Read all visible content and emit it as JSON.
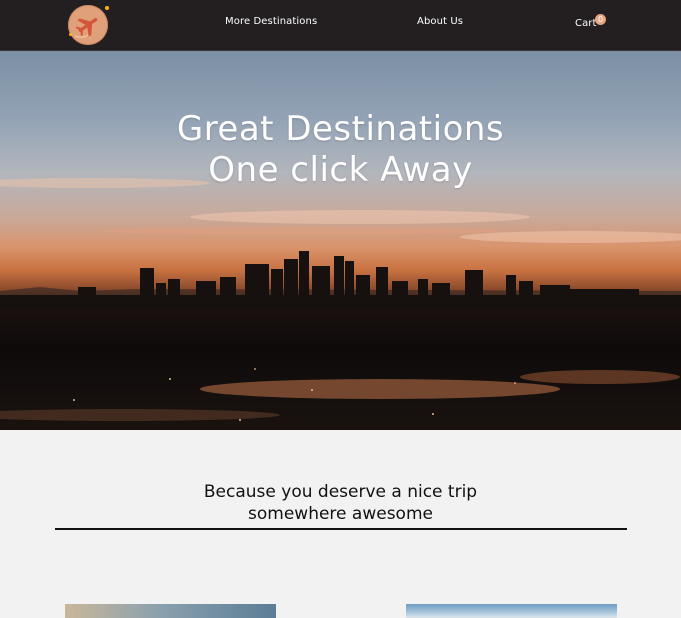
{
  "header": {
    "nav": {
      "more_destinations": "More Destinations",
      "about_us": "About Us",
      "cart_label": "Cart",
      "cart_count": "0"
    },
    "logo_icon": "airplane-logo-icon"
  },
  "hero": {
    "title_line1": "Great Destinations",
    "title_line2": "One click Away",
    "image": "city-skyline-sunset"
  },
  "tagline": {
    "line1": "Because you deserve a nice trip",
    "line2": "somewhere awesome"
  },
  "cards": [
    {
      "image": "beach-sunset-photo"
    },
    {
      "image": "blue-sky-photo"
    }
  ],
  "colors": {
    "header_bg": "#231f20",
    "page_bg": "#f2f2f2",
    "accent": "#e7a582",
    "text_light": "#ffffff",
    "text_dark": "#111111"
  }
}
